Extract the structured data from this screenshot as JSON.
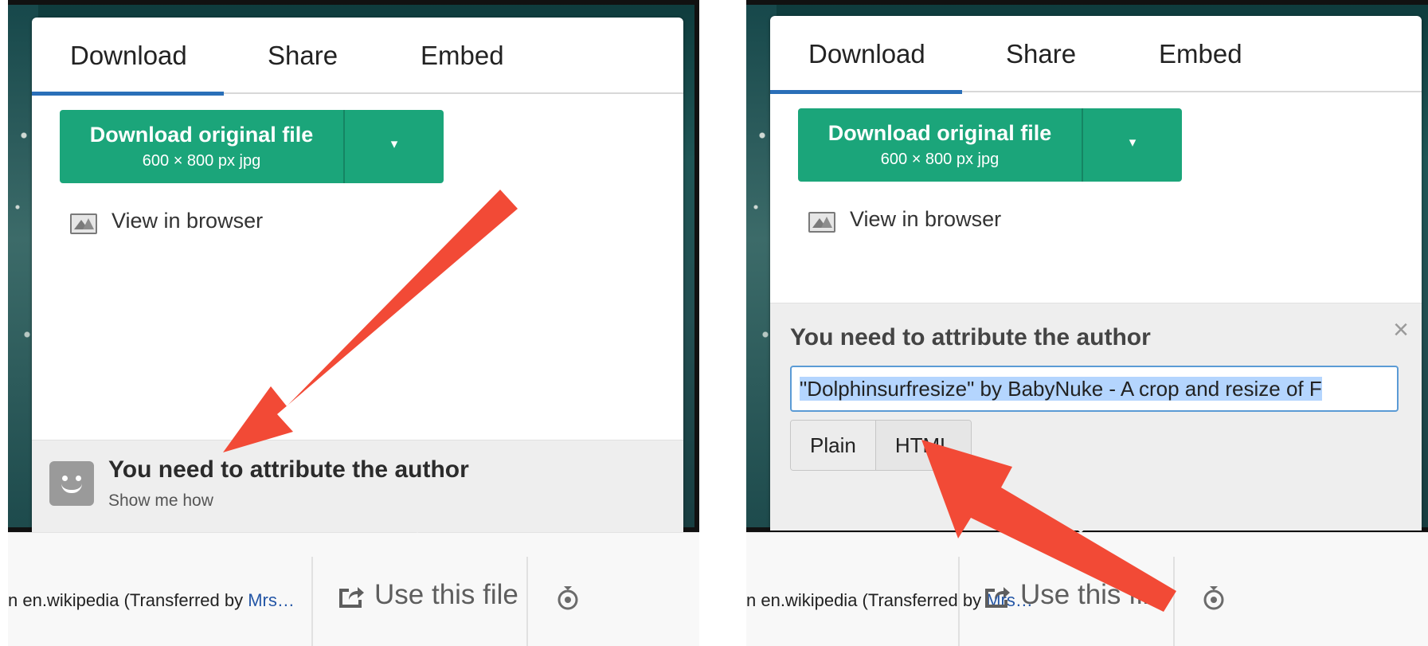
{
  "tabs": [
    "Download",
    "Share",
    "Embed"
  ],
  "download": {
    "title": "Download original file",
    "subtitle": "600 × 800 px jpg",
    "caret": "▾"
  },
  "view_in_browser": "View in browser",
  "attribution_collapsed": {
    "title": "You need to attribute the author",
    "link": "Show me how"
  },
  "attribution_expanded": {
    "title": "You need to attribute the author",
    "close": "×",
    "text": "\"Dolphinsurfresize\" by BabyNuke - A crop and resize of F",
    "formats": [
      "Plain",
      "HTML"
    ]
  },
  "footer": {
    "credit_prefix": "n en.wikipedia (Transferred by ",
    "credit_link": "Mrs…",
    "use_file": "Use this file"
  },
  "colors": {
    "accent_green": "#1ba57a",
    "tab_underline": "#2a6fb8",
    "arrow_red": "#f24a36",
    "selection_blue": "#b4d5fe"
  },
  "icons": [
    "image-icon",
    "smiley-icon",
    "close-icon",
    "share-icon",
    "reuse-icon",
    "chevron-down-icon"
  ]
}
